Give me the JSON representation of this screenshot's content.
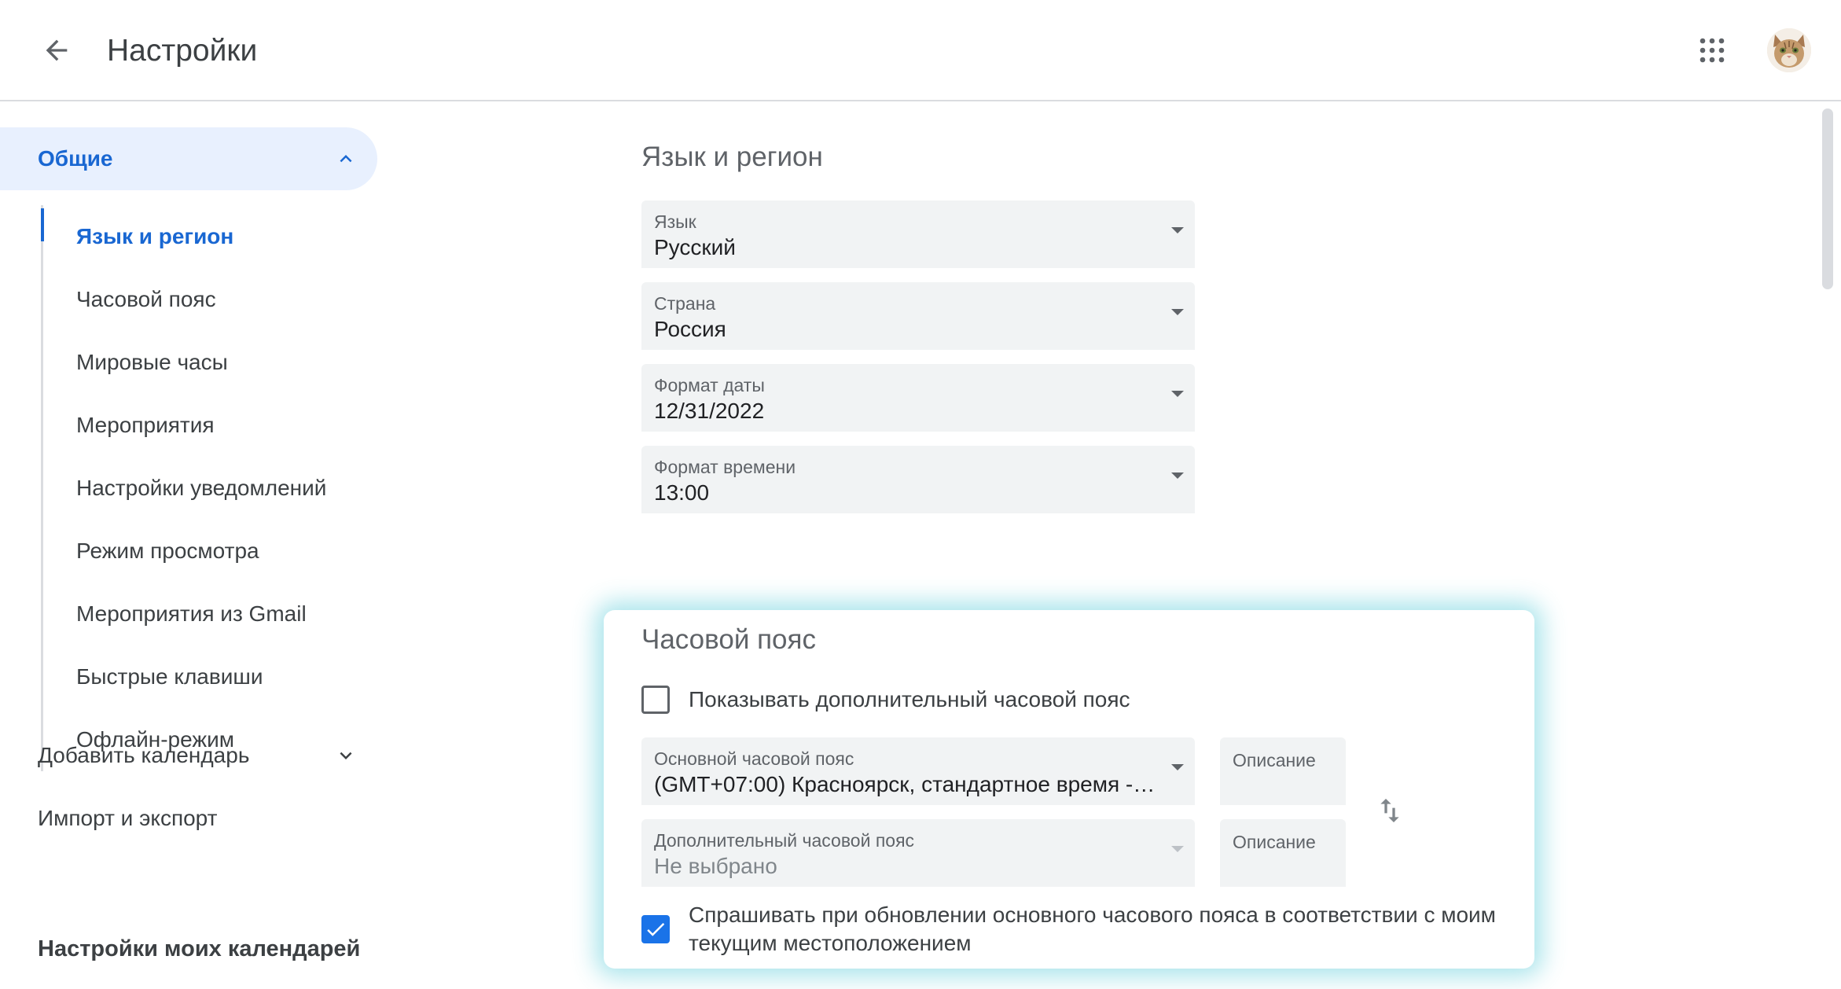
{
  "header": {
    "title": "Настройки",
    "back_icon": "arrow-back-icon",
    "apps_icon": "apps-grid-icon",
    "avatar_icon": "cat-avatar"
  },
  "sidebar": {
    "general": {
      "label": "Общие",
      "expanded": true
    },
    "sub_items": [
      {
        "label": "Язык и регион",
        "active": true
      },
      {
        "label": "Часовой пояс"
      },
      {
        "label": "Мировые часы"
      },
      {
        "label": "Мероприятия"
      },
      {
        "label": "Настройки уведомлений"
      },
      {
        "label": "Режим просмотра"
      },
      {
        "label": "Мероприятия из Gmail"
      },
      {
        "label": "Быстрые клавиши"
      },
      {
        "label": "Офлайн-режим"
      }
    ],
    "add_calendar": "Добавить календарь",
    "import_export": "Импорт и экспорт",
    "my_calendars_section": "Настройки моих календарей"
  },
  "language_region": {
    "title": "Язык и регион",
    "language": {
      "label": "Язык",
      "value": "Русский"
    },
    "country": {
      "label": "Страна",
      "value": "Россия"
    },
    "date_format": {
      "label": "Формат даты",
      "value": "12/31/2022"
    },
    "time_format": {
      "label": "Формат времени",
      "value": "13:00"
    }
  },
  "time_zone": {
    "title": "Часовой пояс",
    "show_secondary": {
      "label": "Показывать дополнительный часовой пояс",
      "checked": false
    },
    "primary": {
      "label": "Основной часовой пояс",
      "value": "(GMT+07:00) Красноярск, стандартное время - ..."
    },
    "primary_description": {
      "label": "Описание"
    },
    "secondary": {
      "label": "Дополнительный часовой пояс",
      "value": "Не выбрано"
    },
    "secondary_description": {
      "label": "Описание"
    },
    "ask_update": {
      "label": "Спрашивать при обновлении основного часового пояса в соответствии с моим текущим местоположением",
      "checked": true
    }
  },
  "colors": {
    "accent": "#1967d2",
    "accent_bg": "#e8f0fe",
    "checkbox_blue": "#1a73e8",
    "highlight_glow": "#40c4d2"
  }
}
